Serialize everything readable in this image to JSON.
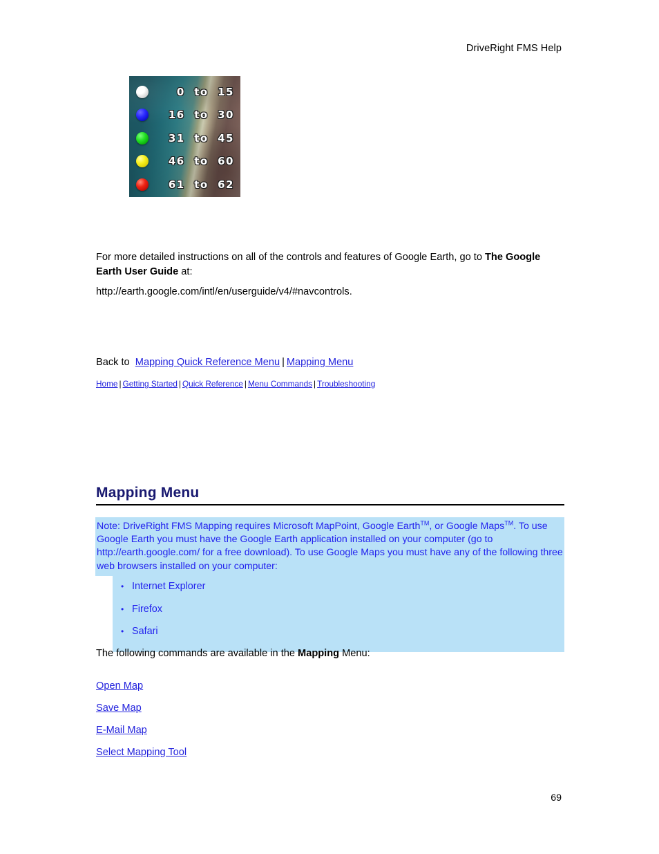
{
  "header": {
    "title": "DriveRight FMS Help"
  },
  "figure": {
    "name": "google-earth-speed-legend",
    "alt": "Google Earth speed range legend over satellite imagery",
    "legend_rows": [
      {
        "color": "#f2f2f2",
        "label": "0  to  15",
        "from": 0,
        "to": 15
      },
      {
        "color": "#1414e6",
        "label": "16  to  30",
        "from": 16,
        "to": 30
      },
      {
        "color": "#0ac40a",
        "label": "31  to  45",
        "from": 31,
        "to": 45
      },
      {
        "color": "#efe80d",
        "label": "46  to  60",
        "from": 46,
        "to": 60
      },
      {
        "color": "#e01010",
        "label": "61  to  62",
        "from": 61,
        "to": 62
      }
    ]
  },
  "body": {
    "instructions_pre": "For more detailed instructions on all of the controls and features of Google Earth, go to ",
    "instructions_bold": "The Google Earth User Guide",
    "instructions_post": " at:",
    "url": "http://earth.google.com/intl/en/userguide/v4/#navcontrols."
  },
  "backto": {
    "prefix": "Back to",
    "links": [
      "Mapping Quick Reference Menu",
      "Mapping Menu"
    ],
    "separator": "|"
  },
  "mininav": {
    "links": [
      "Home",
      "Getting Started",
      "Quick Reference",
      "Menu Commands",
      "Troubleshooting"
    ],
    "separator": "|"
  },
  "section": {
    "heading": "Mapping Menu"
  },
  "note": {
    "line1_a": "Note: DriveRight FMS Mapping requires Microsoft MapPoint, Google Earth",
    "tm1": "TM",
    "line1_b": ", or Google Maps",
    "tm2": "TM",
    "line1_c": ". To use Google Earth you must have the Google Earth application installed on your computer (go to http://earth.google.com/ for a free download). To use Google Maps you must have any of the following three web browsers installed on your computer:",
    "browsers": [
      "Internet Explorer",
      "Firefox",
      "Safari"
    ],
    "bullet_glyph": "•"
  },
  "commands": {
    "intro_pre": "The following commands are available in the ",
    "intro_bold": "Mapping",
    "intro_post": " Menu:",
    "items": [
      "Open Map",
      "Save Map",
      "E-Mail Map",
      "Select Mapping Tool"
    ]
  },
  "footer": {
    "page_number": "69"
  },
  "colors": {
    "heading": "#191970",
    "link": "#2222dd",
    "note_background": "#b9e1f7",
    "note_text": "#2222ee",
    "page_background": "#ffffff"
  }
}
